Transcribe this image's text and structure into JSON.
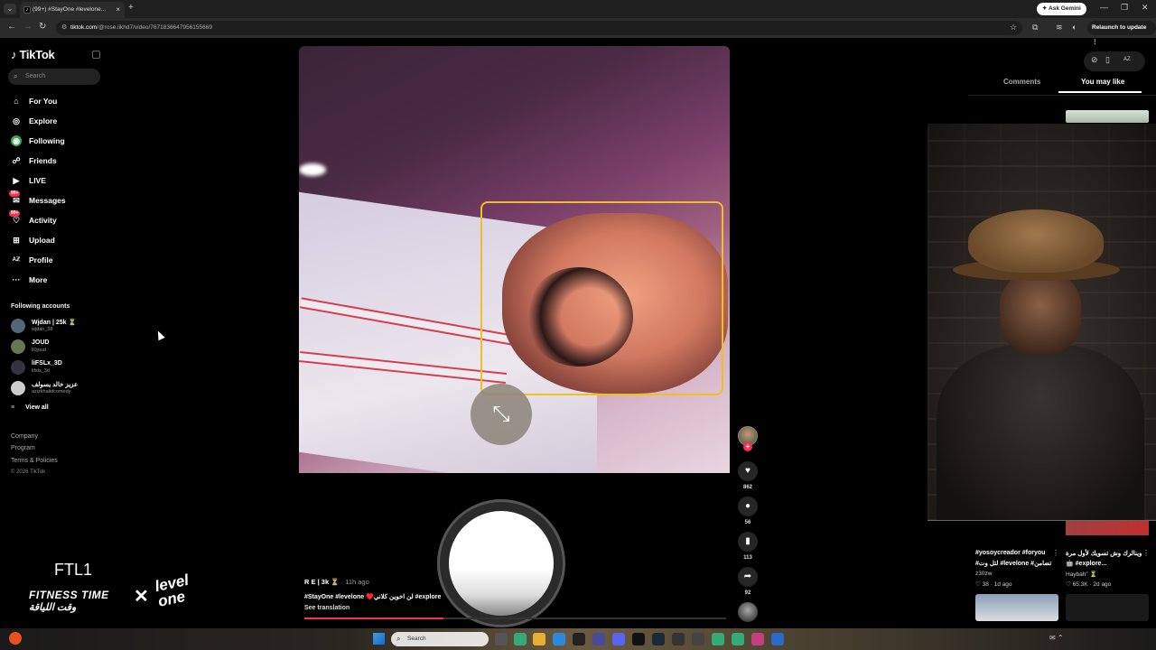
{
  "browser": {
    "tab_menu": "⌄",
    "tab_title": "(99+) #StayOne #levelone...",
    "tab_close": "×",
    "new_tab": "+",
    "gemini_button": "✦ Ask Gemini",
    "minimize": "—",
    "maximize": "❐",
    "close": "✕",
    "url_host": "tiktok.com",
    "url_path": "/@rose.iikhd7/video/7671836647956155669",
    "relaunch": "Relaunch to update ⋮"
  },
  "sidebar": {
    "logo": "♪ TikTok",
    "search_placeholder": "Search",
    "nav": [
      {
        "icon": "⌂",
        "label": "For You"
      },
      {
        "icon": "◎",
        "label": "Explore"
      },
      {
        "icon": "◉",
        "label": "Following"
      },
      {
        "icon": "☍",
        "label": "Friends"
      },
      {
        "icon": "▶",
        "label": "LIVE"
      },
      {
        "icon": "✉",
        "label": "Messages",
        "badge": "99+"
      },
      {
        "icon": "♡",
        "label": "Activity",
        "badge": "99+"
      },
      {
        "icon": "⊞",
        "label": "Upload"
      },
      {
        "icon": "Aℤ",
        "label": "Profile"
      },
      {
        "icon": "···",
        "label": "More"
      }
    ],
    "following_title": "Following accounts",
    "accounts": [
      {
        "name": "Wjdan | 25k ⏳",
        "handle": "wjdan_58"
      },
      {
        "name": "JOUD",
        "handle": "ll0joud"
      },
      {
        "name": "liFSLx_3D",
        "handle": "lifslx_3d"
      },
      {
        "name": "عزيز خالد يسولف",
        "handle": "azizkhalidcomedy"
      }
    ],
    "view_all": "View all",
    "footer": [
      "Company",
      "Program",
      "Terms & Policies"
    ],
    "copyright": "© 2026 TikTok"
  },
  "video": {
    "shrink_icon": "⤡",
    "author": "R E | 3k ⏳",
    "time": "· 11h ago",
    "caption": "#StayOne #levelone ♥️لن اخوين كلاني #explore",
    "translate": "See translation",
    "progress": 0.33
  },
  "actions": [
    {
      "name": "like",
      "icon": "♥",
      "count": "862"
    },
    {
      "name": "comment",
      "icon": "●",
      "count": "56"
    },
    {
      "name": "save",
      "icon": "▮",
      "count": "113"
    },
    {
      "name": "share",
      "icon": "➦",
      "count": "92"
    }
  ],
  "creator_plus": "+",
  "right_panel": {
    "icons": [
      "⊘",
      "▯",
      "AZ"
    ],
    "tabs": [
      "Comments",
      "You may like"
    ],
    "items": [
      {
        "caption1": "#yosoycreador #foryou",
        "caption2": "#لتل وت #levelone #تضامن",
        "user": "z30zw",
        "likes": "♡ 38",
        "age": "· 1d ago"
      },
      {
        "caption1": "وينالرك وش تسويك لأول مرة",
        "caption2": "🤖 #explore...",
        "user": "Haybah\" ⏳",
        "likes": "♡ 65.3K",
        "age": "· 2d ago"
      }
    ],
    "menu": "⋮"
  },
  "branding": {
    "ftl": "FTL1",
    "fitness": "FITNESS TIME",
    "fitness_ar": "وقت اللياقة",
    "x": "✕",
    "level": "level",
    "one": "one"
  },
  "taskbar": {
    "search": "Search",
    "search_icon": "⌕",
    "tray": "✉ ⌃"
  }
}
